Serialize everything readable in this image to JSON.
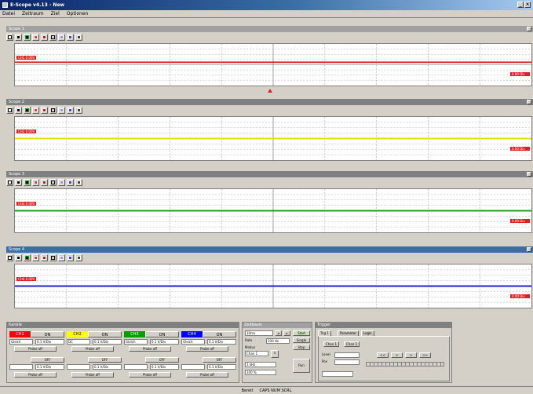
{
  "window": {
    "title": "E-Scope v4.13 - New"
  },
  "menu": [
    "Datei",
    "Zeitraum",
    "Ziel",
    "Optionen"
  ],
  "colors": {
    "ch1": "#ff0000",
    "ch2": "#ffff00",
    "ch3": "#00a000",
    "ch4": "#0000ff",
    "titlebar": "#0a246a"
  },
  "scopes": [
    {
      "title": "Scope 1",
      "trace_color": "#e02020",
      "label": "CH1 0.00V",
      "right_label": "0.00 Div"
    },
    {
      "title": "Scope 2",
      "trace_color": "#e8e000",
      "label": "CH2 0.00V",
      "right_label": "0.00 Div"
    },
    {
      "title": "Scope 3",
      "trace_color": "#20a020",
      "label": "CH3 0.00V",
      "right_label": "0.00 Div"
    },
    {
      "title": "Scope 4",
      "trace_color": "#2020d0",
      "label": "CH4 0.00V",
      "right_label": "0.00 Div"
    }
  ],
  "channels_panel": {
    "title": "Kanäle",
    "channels": [
      {
        "name": "CH1",
        "on": "ON",
        "coupling": "Gleich",
        "range": "0.1 V/Div",
        "probe": "Probe off",
        "off_on": "OFF",
        "coupling2": "",
        "range2": "0.1 V/Div",
        "probe2": "Probe off"
      },
      {
        "name": "CH2",
        "on": "ON",
        "coupling": "DC",
        "range": "0.1 V/Div",
        "probe": "Probe off",
        "off_on": "OFF",
        "coupling2": "",
        "range2": "0.1 V/Div",
        "probe2": "Probe off"
      },
      {
        "name": "CH3",
        "on": "ON",
        "coupling": "Gleich",
        "range": "0.1 V/Div",
        "probe": "Probe off",
        "off_on": "OFF",
        "coupling2": "",
        "range2": "0.1 V/Div",
        "probe2": "Probe off"
      },
      {
        "name": "CH4",
        "on": "ON",
        "coupling": "Gleich",
        "range": "0.1 V/Div",
        "probe": "Probe off",
        "off_on": "OFF",
        "coupling2": "",
        "range2": "0.1 V/Div",
        "probe2": "Probe off"
      }
    ]
  },
  "timebase_panel": {
    "title": "Zeitbasis",
    "time_div": "10ms",
    "rate_label": "Rate",
    "rate_value": "100 Hz",
    "mode_label": "Modus",
    "mode_value": "Chan 1",
    "samples": "Sample",
    "start": "Start",
    "single": "Single",
    "stop": "Stop",
    "run": "Run",
    "sample_rate": "1 kHz",
    "dots": "100 %"
  },
  "trigger_panel": {
    "title": "Trigger",
    "tabs": [
      "Trig 1",
      "Parameter",
      "Logik"
    ],
    "src1": "Chan 1",
    "src2": "Chan 2",
    "level_label": "Level",
    "pos_label": "Pos",
    "buttons": [
      "<<",
      "<",
      ">",
      ">>"
    ]
  },
  "status": {
    "left": "Bereit",
    "right": "CAPS NUM SCRL"
  }
}
